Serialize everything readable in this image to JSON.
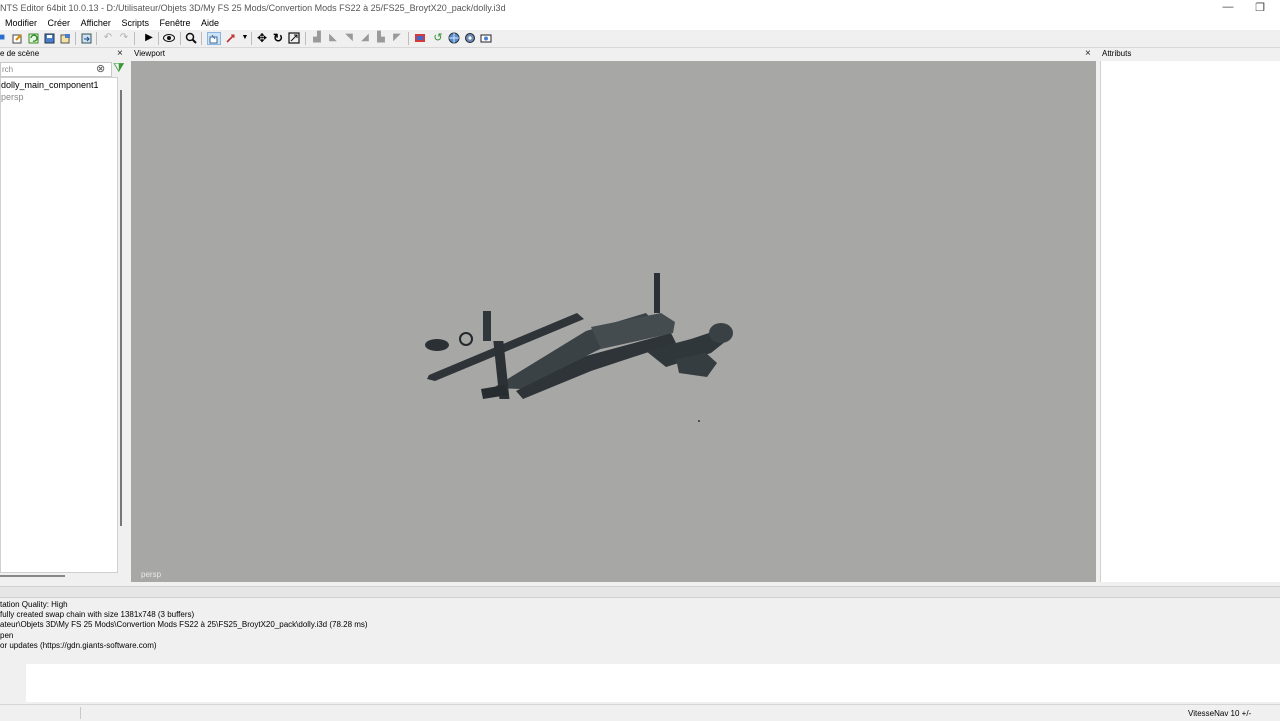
{
  "window": {
    "title": "NTS Editor 64bit 10.0.13 - D:/Utilisateur/Objets 3D/My FS 25 Mods/Convertion Mods FS22 à 25/FS25_BroytX20_pack/dolly.i3d",
    "minimize_glyph": "—",
    "restore_glyph": "❐"
  },
  "menu": [
    "Modifier",
    "Créer",
    "Afficher",
    "Scripts",
    "Fenêtre",
    "Aide"
  ],
  "scene_panel": {
    "title": "e de scène",
    "search_placeholder": "rch",
    "items": [
      "dolly_main_component1",
      "persp"
    ]
  },
  "viewport": {
    "title": "Viewport",
    "camera_label": "persp"
  },
  "attributes_panel": {
    "title": "Attributs"
  },
  "console": {
    "lines": [
      "tation Quality: High",
      "fully created swap chain with size 1381x748 (3 buffers)",
      "ateur\\Objets 3D\\My FS 25 Mods\\Convertion Mods FS22 à 25\\FS25_BroytX20_pack\\dolly.i3d (78.28 ms)",
      "pen",
      "or updates (https://gdn.giants-software.com)"
    ]
  },
  "statusbar": {
    "nav_speed": "VitesseNav 10 +/-"
  },
  "icons": {
    "close": "×",
    "play": "▶",
    "search": "⚲",
    "clear": "⊗",
    "filter": "⧩"
  },
  "colors": {
    "viewport_bg": "#a7a7a5",
    "panel_bg": "#f0f0f0",
    "model_dark": "#2e3438"
  }
}
